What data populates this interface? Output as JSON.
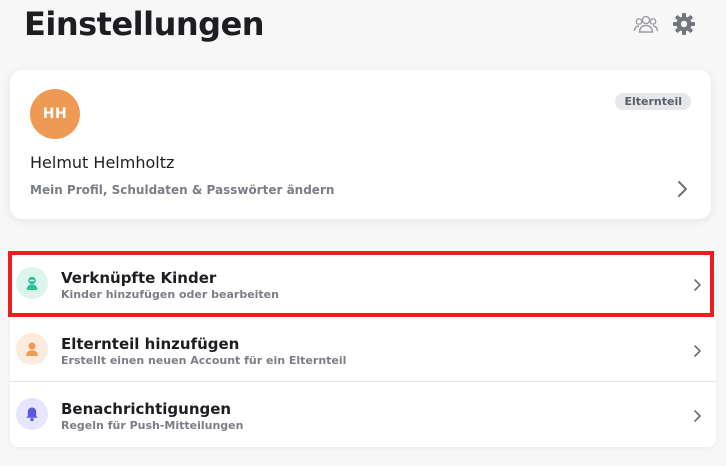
{
  "header": {
    "title": "Einstellungen",
    "icons": [
      "group-icon",
      "gear-icon"
    ]
  },
  "profile": {
    "initials": "HH",
    "name": "Helmut Helmholtz",
    "subtitle": "Mein Profil, Schuldaten & Passwörter ändern",
    "role": "Elternteil",
    "avatar_color": "#ef9a54"
  },
  "settings": [
    {
      "title": "Verknüpfte Kinder",
      "subtitle": "Kinder hinzufügen oder bearbeiten",
      "icon": "child-icon",
      "icon_color": "#2bbf9a",
      "icon_bg": "#def5ee",
      "highlighted": true
    },
    {
      "title": "Elternteil hinzufügen",
      "subtitle": "Erstellt einen neuen Account für ein Elternteil",
      "icon": "person-icon",
      "icon_color": "#ef9a54",
      "icon_bg": "#fcebdc"
    },
    {
      "title": "Benachrichtigungen",
      "subtitle": "Regeln für Push-Mitteilungen",
      "icon": "bell-icon",
      "icon_color": "#5d57e6",
      "icon_bg": "#e6e5fb"
    }
  ],
  "colors": {
    "highlight": "#ee1c1c",
    "background": "#f7f7f8"
  }
}
